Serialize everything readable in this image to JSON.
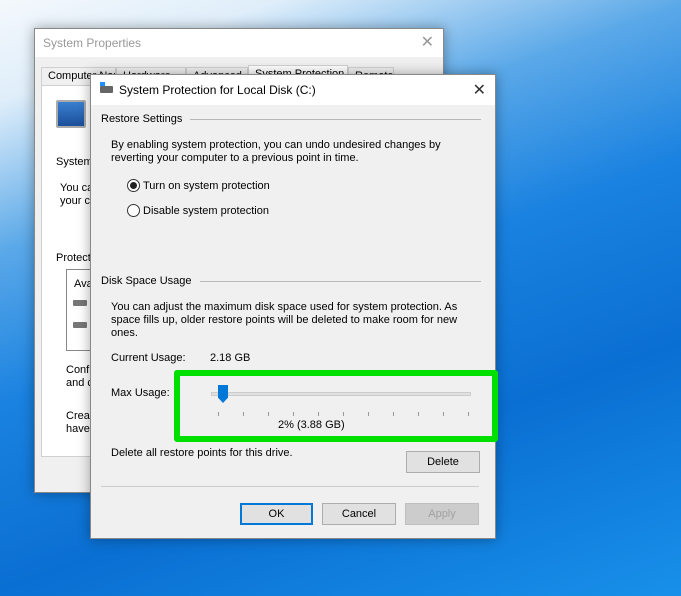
{
  "back_window": {
    "title": "System Properties",
    "tabs": [
      "Computer Name",
      "Hardware",
      "Advanced",
      "System Protection",
      "Remote"
    ],
    "section_label": "System",
    "desc_line1": "You ca",
    "desc_line2": "your c",
    "protection_label": "Protecti",
    "list_header": "Ava",
    "config_line1": "Confi",
    "config_line2": "and c",
    "create_line1": "Creat",
    "create_line2": "have"
  },
  "dialog": {
    "title": "System Protection for Local Disk (C:)",
    "restore_settings": {
      "heading": "Restore Settings",
      "description_line1": "By enabling system protection, you can undo undesired changes by",
      "description_line2": "reverting your computer to a previous point in time.",
      "options": [
        {
          "label": "Turn on system protection",
          "selected": true
        },
        {
          "label": "Disable system protection",
          "selected": false
        }
      ]
    },
    "disk_space": {
      "heading": "Disk Space Usage",
      "description_line1": "You can adjust the maximum disk space used for system protection. As",
      "description_line2": "space fills up, older restore points will be deleted to make room for new",
      "description_line3": "ones.",
      "current_usage_label": "Current Usage:",
      "current_usage_value": "2.18 GB",
      "max_usage_label": "Max Usage:",
      "max_usage_percent": 2,
      "max_usage_text": "2% (3.88 GB)",
      "delete_text": "Delete all restore points for this drive.",
      "delete_button": "Delete"
    },
    "buttons": {
      "ok": "OK",
      "cancel": "Cancel",
      "apply": "Apply"
    }
  },
  "highlight_color": "#00e000",
  "accent": "#0078d7"
}
